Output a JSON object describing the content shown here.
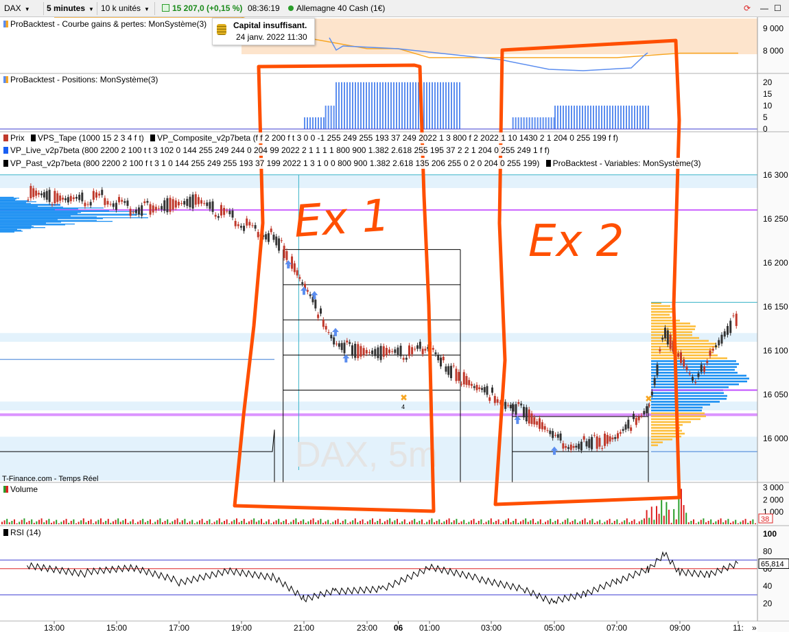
{
  "toolbar": {
    "symbol": "DAX",
    "timeframe": "5 minutes",
    "units": "10 k unités",
    "price_change": "15 207,0 (+0,15 %)",
    "time": "08:36:19",
    "instrument": "Allemagne 40 Cash (1€)"
  },
  "tooltip": {
    "title": "Capital insuffisant.",
    "date": "24 janv. 2022 11:30"
  },
  "annotations": {
    "ex1": "Ex 1",
    "ex2": "Ex 2"
  },
  "watermark": "DAX, 5m",
  "source": "T-Finance.com - Temps Réel",
  "trade_label": "4",
  "colors": {
    "up": "#c0392b",
    "down": "#333333",
    "profile_blue": "#1a8ff2",
    "profile_orange": "#fdbe3c",
    "annotation": "#ff4f00",
    "pivot": "#cc66ff"
  },
  "chart_data": [
    {
      "type": "area",
      "title": "ProBacktest - Courbe gains & pertes: MonSystème(3)",
      "ylim": [
        7000,
        9500
      ],
      "yticks": [
        "9 000",
        "8 000"
      ],
      "x": [
        "13:00",
        "15:00",
        "17:00",
        "19:00",
        "21:00",
        "23:00",
        "06",
        "01:00",
        "03:00",
        "05:00",
        "07:00",
        "09:00",
        "11:"
      ],
      "values": [
        9500,
        9500,
        9500,
        9500,
        8600,
        8100,
        8100,
        7700,
        7700,
        7700,
        7700,
        7900,
        7900
      ]
    },
    {
      "type": "bar",
      "title": "ProBacktest - Positions: MonSystème(3)",
      "ylim": [
        0,
        22
      ],
      "yticks": [
        "20",
        "15",
        "10",
        "5",
        "0"
      ],
      "x": [
        "20:20",
        "21:00",
        "21:40",
        "22:00",
        "02:00",
        "03:40",
        "05:00",
        "08:00"
      ],
      "values": [
        0,
        5,
        10,
        20,
        0,
        5,
        10,
        0
      ]
    },
    {
      "type": "line",
      "title": "Prix",
      "legend": [
        "Prix",
        "VPS_Tape (1000 15 2 3 4 f t)",
        "VP_Composite_v2p7beta (f f 2 200 f t 3 0 0 -1 255 249 255 193 37 249 2022 1 3 800 f 2 2022 1 10 1430 2 1 204 0 255 199 f f)",
        "VP_Live_v2p7beta (800 2200 2 100 t t 3 102 0 144 255 249 244 0 204 99 2022 2 1 1 1 1 800 900 1.382 2.618 255 195 37 2 2 1 204 0 255 249 1 f f)",
        "VP_Past_v2p7beta (800 2200 2 100 f t 3 1 0 144 255 249 255 193 37 199 2022 1 3 1 0 0 800 900 1.382 2.618 135 206 255 0 2 0 204 0 255 199)",
        "ProBacktest - Variables: MonSystème(3)"
      ],
      "ylim": [
        15950,
        16310
      ],
      "yticks": [
        "16 300",
        "16 250",
        "16 200",
        "16 150",
        "16 100",
        "16 050",
        "16 000"
      ],
      "x": [
        "12:30",
        "13:30",
        "14:30",
        "15:30",
        "16:30",
        "17:30",
        "18:30",
        "19:30",
        "20:00",
        "20:30",
        "21:00",
        "21:30",
        "22:00",
        "22:30",
        "23:30",
        "00:30",
        "01:00",
        "01:30",
        "02:00",
        "02:30",
        "03:00",
        "03:30",
        "04:00",
        "04:30",
        "05:00",
        "05:30",
        "06:00",
        "06:30",
        "07:00",
        "07:30",
        "08:00",
        "08:30",
        "09:00",
        "09:30",
        "10:00",
        "10:30",
        "11:00"
      ],
      "values": [
        16280,
        16270,
        16275,
        16260,
        16265,
        16270,
        16255,
        16235,
        16230,
        16205,
        16170,
        16140,
        16110,
        16100,
        16097,
        16098,
        16110,
        16080,
        16070,
        16055,
        16050,
        16040,
        16030,
        16015,
        16000,
        15993,
        15995,
        15997,
        16000,
        16020,
        16040,
        16120,
        16090,
        16060,
        16100,
        16120,
        16140
      ]
    },
    {
      "type": "bar",
      "title": "Volume",
      "ylim": [
        0,
        3200
      ],
      "yticks": [
        "3 000",
        "2 000",
        "1 000"
      ],
      "note": "mostly low volume, spike near 08:00"
    },
    {
      "type": "line",
      "title": "RSI (14)",
      "ylim": [
        0,
        100
      ],
      "yticks": [
        "100",
        "80",
        "60",
        "40",
        "20"
      ],
      "levels": [
        70,
        60,
        30
      ],
      "last_value": "65,814",
      "x": [
        "12:30",
        "14:00",
        "15:30",
        "17:00",
        "18:30",
        "20:00",
        "21:00",
        "22:00",
        "23:30",
        "01:00",
        "02:30",
        "04:00",
        "05:00",
        "06:00",
        "07:00",
        "08:00",
        "08:30",
        "09:00",
        "10:00",
        "11:00"
      ],
      "values": [
        65,
        55,
        60,
        45,
        58,
        50,
        25,
        35,
        38,
        62,
        50,
        38,
        22,
        30,
        45,
        60,
        78,
        55,
        52,
        65
      ]
    }
  ],
  "time_axis": [
    "13:00",
    "15:00",
    "17:00",
    "19:00",
    "21:00",
    "23:00",
    "06",
    "01:00",
    "03:00",
    "05:00",
    "07:00",
    "09:00",
    "11:"
  ],
  "volume_tag": "38"
}
